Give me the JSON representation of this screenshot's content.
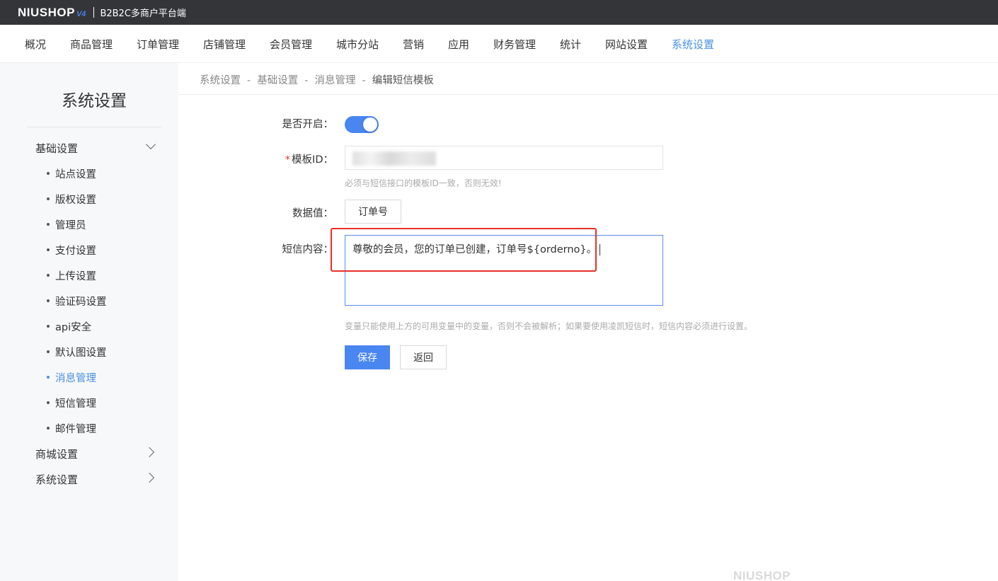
{
  "topbar": {
    "logo_text": "NIUSHOP",
    "logo_version": "V4",
    "platform_label": "B2B2C多商户平台端"
  },
  "nav": {
    "items": [
      "概况",
      "商品管理",
      "订单管理",
      "店铺管理",
      "会员管理",
      "城市分站",
      "营销",
      "应用",
      "财务管理",
      "统计",
      "网站设置",
      "系统设置"
    ],
    "active": "系统设置"
  },
  "sidebar": {
    "title": "系统设置",
    "groups": [
      {
        "label": "基础设置",
        "expanded": true,
        "items": [
          "站点设置",
          "版权设置",
          "管理员",
          "支付设置",
          "上传设置",
          "验证码设置",
          "api安全",
          "默认图设置",
          "消息管理",
          "短信管理",
          "邮件管理"
        ],
        "active_item": "消息管理"
      },
      {
        "label": "商城设置",
        "expanded": false
      },
      {
        "label": "系统设置",
        "expanded": false
      }
    ]
  },
  "breadcrumb": [
    "系统设置",
    "基础设置",
    "消息管理",
    "编辑短信模板"
  ],
  "form": {
    "enable_label": "是否开启：",
    "enable_on": true,
    "template_id_label": "模板ID：",
    "template_id_required_mark": "*",
    "template_id_hint": "必须与短信接口的模板ID一致，否则无效!",
    "data_value_label": "数据值：",
    "data_value_button": "订单号",
    "content_label": "短信内容：",
    "content_value": "尊敬的会员，您的订单已创建，订单号${orderno}。",
    "content_hint": "变量只能使用上方的可用变量中的变量，否则不会被解析；如果要使用凌凯短信时，短信内容必须进行设置。",
    "save_label": "保存",
    "back_label": "返回"
  },
  "watermark": "NIUSHOP",
  "colors": {
    "accent": "#4a86f0",
    "highlight": "#e8302a",
    "topbar_bg": "#333538"
  }
}
